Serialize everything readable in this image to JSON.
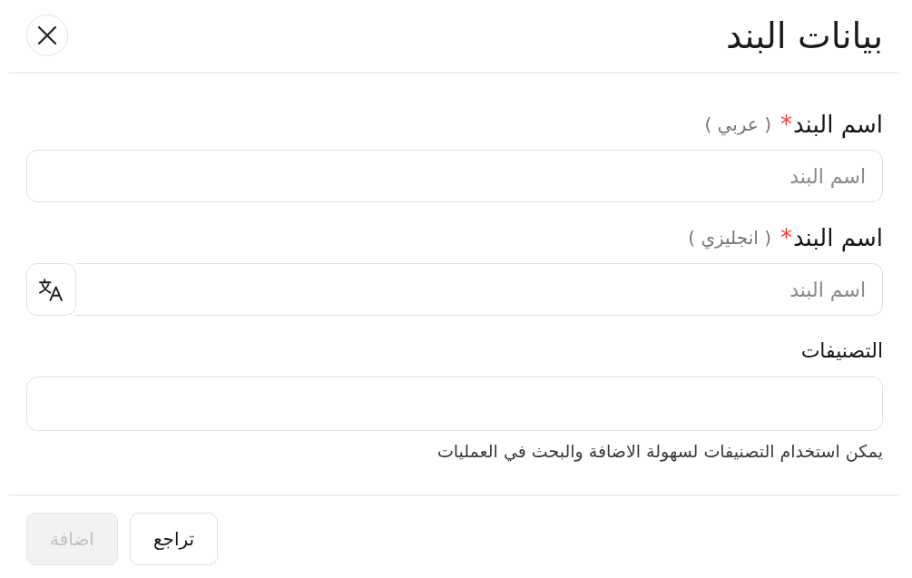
{
  "dialog": {
    "title": "بيانات البند"
  },
  "fields": [
    {
      "kind": "text",
      "label": "اسم البند",
      "required_mark": "*",
      "hint": "( عربي )",
      "placeholder": "اسم البند"
    },
    {
      "kind": "translate",
      "label": "اسم البند",
      "required_mark": "*",
      "hint": "( انجليزي )",
      "placeholder": "اسم البند"
    },
    {
      "kind": "tags",
      "label": "التصنيفات",
      "help": "يمكن استخدام التصنيفات لسهولة الاضافة والبحث في العمليات"
    }
  ],
  "buttons": [
    {
      "kind": "secondary",
      "label": "تراجع",
      "disabled": false
    },
    {
      "kind": "primary",
      "label": "اضافة",
      "disabled": true
    }
  ]
}
